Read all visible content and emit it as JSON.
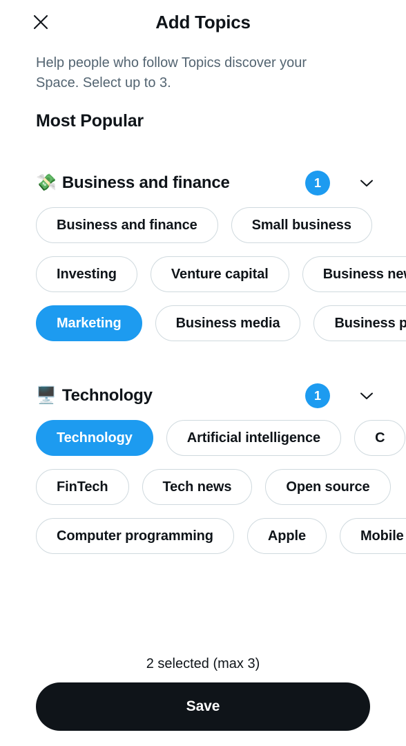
{
  "header": {
    "title": "Add Topics",
    "close_icon": "close-icon"
  },
  "subtitle": "Help people who follow Topics discover your Space. Select up to 3.",
  "section_title": "Most Popular",
  "groups": [
    {
      "emoji": "💸",
      "emoji_name": "money-with-wings-emoji",
      "name": "Business and finance",
      "badge": "1",
      "chevron_icon": "chevron-down-icon",
      "rows": [
        [
          {
            "label": "Business and finance",
            "selected": false
          },
          {
            "label": "Small business",
            "selected": false
          }
        ],
        [
          {
            "label": "Investing",
            "selected": false
          },
          {
            "label": "Venture capital",
            "selected": false
          },
          {
            "label": "Business news",
            "selected": false
          }
        ],
        [
          {
            "label": "Marketing",
            "selected": true
          },
          {
            "label": "Business media",
            "selected": false
          },
          {
            "label": "Business personalities",
            "selected": false
          }
        ]
      ]
    },
    {
      "emoji": "🖥️",
      "emoji_name": "desktop-computer-emoji",
      "name": "Technology",
      "badge": "1",
      "chevron_icon": "chevron-down-icon",
      "rows": [
        [
          {
            "label": "Technology",
            "selected": true
          },
          {
            "label": "Artificial intelligence",
            "selected": false
          },
          {
            "label": "C",
            "selected": false
          }
        ],
        [
          {
            "label": "FinTech",
            "selected": false
          },
          {
            "label": "Tech news",
            "selected": false
          },
          {
            "label": "Open source",
            "selected": false
          }
        ],
        [
          {
            "label": "Computer programming",
            "selected": false
          },
          {
            "label": "Apple",
            "selected": false
          },
          {
            "label": "Mobile",
            "selected": false
          }
        ]
      ]
    }
  ],
  "footer": {
    "select_count": "2 selected (max 3)",
    "save_label": "Save"
  },
  "colors": {
    "accent": "#1d9bf0",
    "text_primary": "#0f1419",
    "text_secondary": "#536471",
    "border": "#cfd9de",
    "button_bg": "#0f1419"
  }
}
